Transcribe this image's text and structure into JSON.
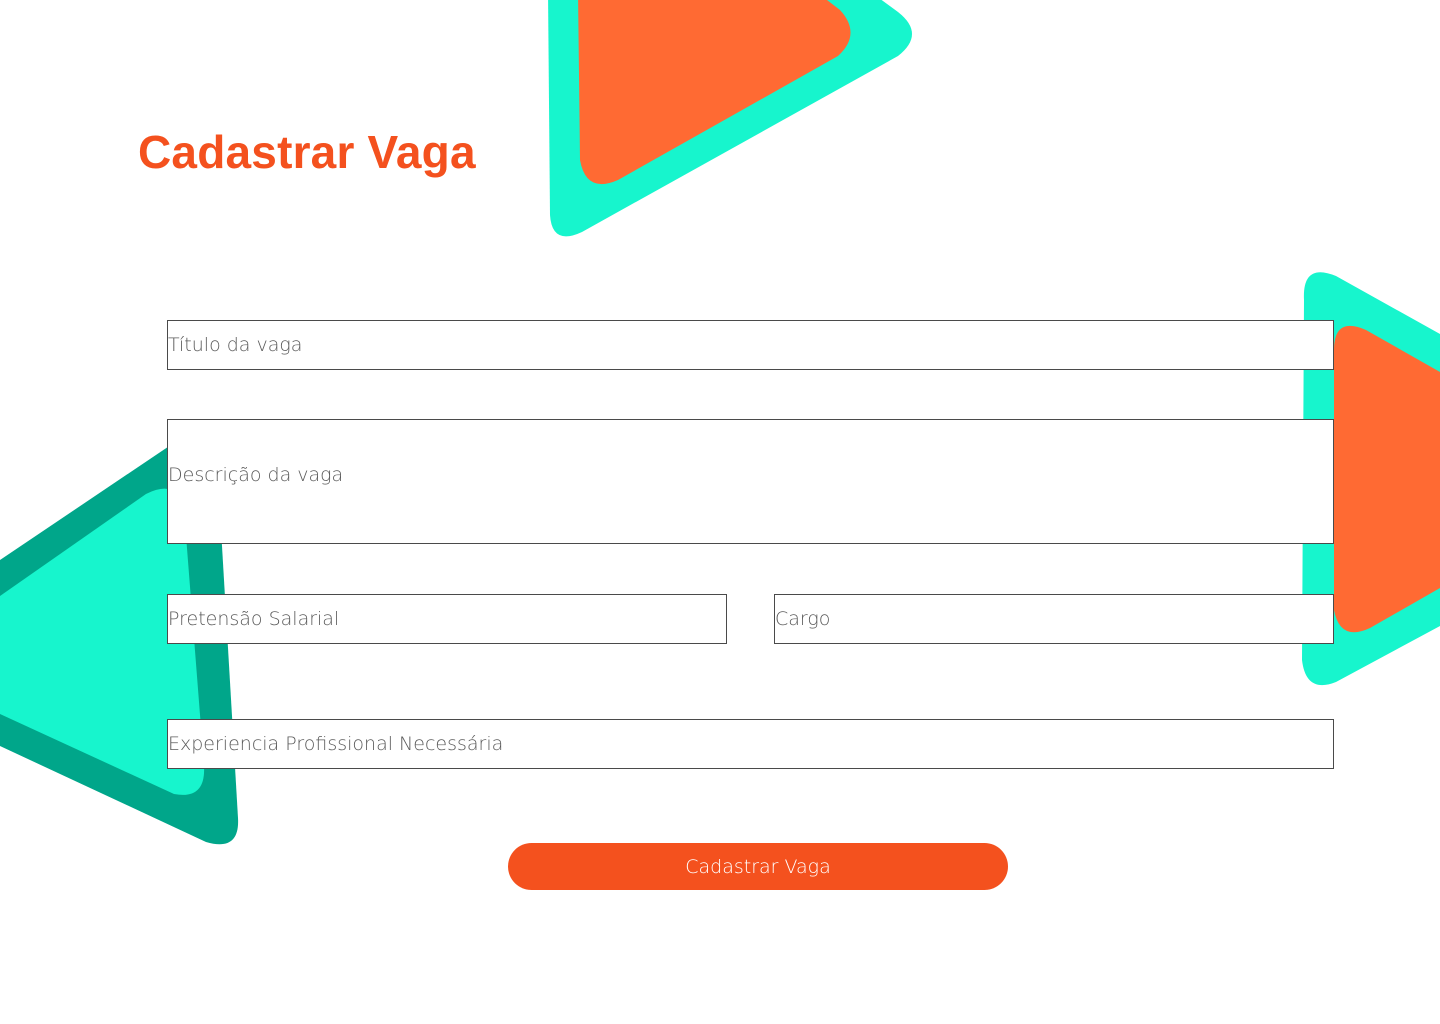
{
  "page": {
    "title": "Cadastrar Vaga"
  },
  "form": {
    "titulo_placeholder": "Título da vaga",
    "descricao_placeholder": "Descrição da vaga",
    "salario_placeholder": "Pretensão Salarial",
    "cargo_placeholder": "Cargo",
    "experiencia_placeholder": "Experiencia Profissional Necessária",
    "submit_label": "Cadastrar Vaga"
  },
  "colors": {
    "accent_orange": "#f4511e",
    "shape_orange": "#ff6a33",
    "shape_cyan": "#17f5cd",
    "shape_teal": "#00a68a",
    "border": "#4a4a4a"
  }
}
